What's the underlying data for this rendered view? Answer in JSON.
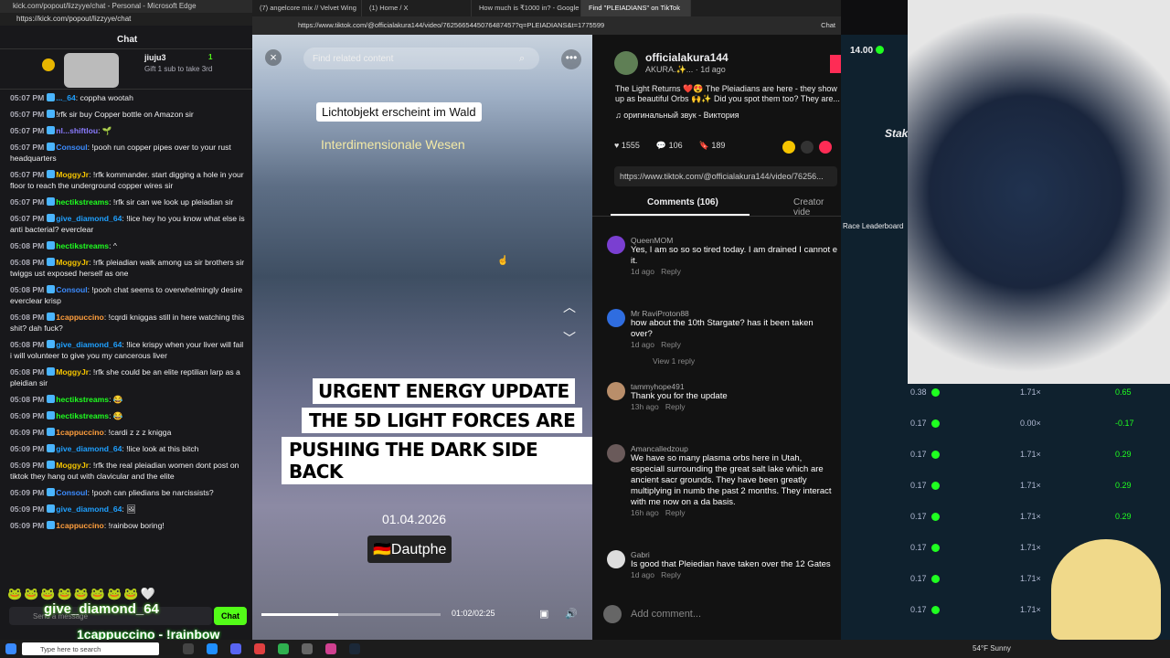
{
  "left": {
    "title": "kick.com/popout/lizzyye/chat - Personal - Microsoft Edge",
    "url": "https://kick.com/popout/lizzyye/chat",
    "header": "Chat",
    "pin_user": "jiuju3",
    "pin_count": "1",
    "pin_text": "Gift 1 sub to take 3rd",
    "messages": [
      {
        "t": "05:07 PM",
        "u": "..._64",
        "c": "#1fa0ff",
        "m": ": coppha wootah"
      },
      {
        "t": "05:07 PM",
        "u": "",
        "c": "#e05b5b",
        "m": "!rfk sir buy Copper bottle on Amazon sir"
      },
      {
        "t": "05:07 PM",
        "u": "nl...shiftlou",
        "c": "#8a7bff",
        "m": ": 🌱"
      },
      {
        "t": "05:07 PM",
        "u": "Consoul",
        "c": "#3c8cff",
        "m": ": !pooh run copper pipes over to your rust headquarters"
      },
      {
        "t": "05:07 PM",
        "u": "MoggyJr",
        "c": "#f5c400",
        "m": ": !rfk kommander. start digging a hole in your floor to reach the underground copper wires sir"
      },
      {
        "t": "05:07 PM",
        "u": "hectikstreams",
        "c": "#1fff20",
        "m": ": !rfk sir can we look up pleiadian sir"
      },
      {
        "t": "05:07 PM",
        "u": "give_diamond_64",
        "c": "#1fa0ff",
        "m": ": !lice hey ho you know what else is anti bacterial? everclear"
      },
      {
        "t": "05:08 PM",
        "u": "hectikstreams",
        "c": "#1fff20",
        "m": ": ^"
      },
      {
        "t": "05:08 PM",
        "u": "MoggyJr",
        "c": "#f5c400",
        "m": ": !rfk pleiadian walk among us sir brothers sir twiggs ust exposed herself as one"
      },
      {
        "t": "05:08 PM",
        "u": "Consoul",
        "c": "#3c8cff",
        "m": ": !pooh chat seems to overwhelmingly desire everclear krisp"
      },
      {
        "t": "05:08 PM",
        "u": "1cappuccino",
        "c": "#ff9e3d",
        "m": ": !cqrdi kniggas still in here watching this shit? dah fuck?"
      },
      {
        "t": "05:08 PM",
        "u": "give_diamond_64",
        "c": "#1fa0ff",
        "m": ": !lice krispy when your liver will fail i will volunteer to give you my cancerous liver"
      },
      {
        "t": "05:08 PM",
        "u": "MoggyJr",
        "c": "#f5c400",
        "m": ": !rfk she could be an elite reptilian larp as a pleidian sir"
      },
      {
        "t": "05:08 PM",
        "u": "hectikstreams",
        "c": "#1fff20",
        "m": ": 😂"
      },
      {
        "t": "05:09 PM",
        "u": "hectikstreams",
        "c": "#1fff20",
        "m": ": 😂"
      },
      {
        "t": "05:09 PM",
        "u": "1cappuccino",
        "c": "#ff9e3d",
        "m": ": !cardi z z z knigga"
      },
      {
        "t": "05:09 PM",
        "u": "give_diamond_64",
        "c": "#1fa0ff",
        "m": ": !lice look at this bitch"
      },
      {
        "t": "05:09 PM",
        "u": "MoggyJr",
        "c": "#f5c400",
        "m": ": !rfk the real pleiadian women dont post on tiktok they hang out with clavicular and the elite"
      },
      {
        "t": "05:09 PM",
        "u": "Consoul",
        "c": "#3c8cff",
        "m": ": !pooh can pliedians be narcissists?"
      },
      {
        "t": "05:09 PM",
        "u": "give_diamond_64",
        "c": "#1fa0ff",
        "m": ": 🖼"
      },
      {
        "t": "05:09 PM",
        "u": "1cappuccino",
        "c": "#ff9e3d",
        "m": ": !rainbow boring!"
      }
    ],
    "input_placeholder": "Send a message",
    "chat_button": "Chat",
    "ticker1": "give_diamond_64",
    "ticker2": "1cappuccino - !rainbow boring!"
  },
  "browser": {
    "tabs": [
      "(7) angelcore mix // Velvet Wing",
      "(1) Home / X",
      "How much is ₹1000 in? - Google",
      "Find \"PLEIADIANS\" on TikTok"
    ],
    "url": "https://www.tiktok.com/@officialakura144/video/7625665445076487457?q=PLEIADIANS&t=1775599",
    "chat_btn": "Chat"
  },
  "video": {
    "search": "Find related content",
    "cap1": "Lichtobjekt erscheint im Wald",
    "cap2": "Interdimensionale Wesen",
    "h1": "URGENT ENERGY UPDATE",
    "h2": "THE 5D LIGHT FORCES ARE",
    "h3": "PUSHING THE DARK SIDE BACK",
    "date": "01.04.2026",
    "place": "🇩🇪Dautphe",
    "time": "01:02/02:25",
    "progress": 0.43
  },
  "panel": {
    "user": "officialakura144",
    "sub": "AKURA.✨... · 1d ago",
    "desc": "The Light Returns ❤️😍 The Pleiadians are here - they show up as beautiful Orbs 🙌✨ Did you spot them too? They are...",
    "sound": "♫ оригинальный звук - Виктория",
    "likes": "1555",
    "comments": "106",
    "saves": "189",
    "link": "https://www.tiktok.com/@officialakura144/video/76256...",
    "tab_comments": "Comments (106)",
    "tab_creator": "Creator vide",
    "list": [
      {
        "n": "QueenMOM",
        "m": "Yes, I am so so so tired today. I am drained I cannot e it.",
        "meta": "1d ago",
        "c": "#7a3fd1"
      },
      {
        "n": "Mr RaviProton88",
        "m": "how about the 10th Stargate? has it been taken over?",
        "meta": "1d ago",
        "c": "#2f6de0"
      },
      {
        "n": "tammyhope491",
        "m": "Thank you for the update",
        "meta": "13h ago",
        "c": "#b98e6a"
      },
      {
        "n": "Amancalledzoup",
        "m": "We have so many plasma orbs here in Utah, especiall surrounding the great salt lake which are ancient sacr grounds. They have been greatly multiplying in numb the past 2 months. They interact with me now on a da basis.",
        "meta": "16h ago",
        "c": "#6a5a5a"
      },
      {
        "n": "Gabri",
        "m": "Is good that Pleiedian have taken over the 12 Gates",
        "meta": "1d ago",
        "c": "#ddd"
      }
    ],
    "reply": "Reply",
    "view_reply": "View 1 reply",
    "add_comment": "Add comment..."
  },
  "stake": {
    "balance": "14.00",
    "race": "Race Leaderboard",
    "logo": "Stake",
    "rows": [
      [
        "0.38",
        "1.71×",
        "0.65"
      ],
      [
        "0.17",
        "0.00×",
        "-0.17"
      ],
      [
        "0.17",
        "1.71×",
        "0.29"
      ],
      [
        "0.17",
        "1.71×",
        "0.29"
      ],
      [
        "0.17",
        "1.71×",
        "0.29"
      ],
      [
        "0.17",
        "1.71×",
        ""
      ],
      [
        "0.17",
        "1.71×",
        ""
      ],
      [
        "0.17",
        "1.71×",
        ""
      ]
    ]
  },
  "taskbar": {
    "search": "Type here to search",
    "weather": "54°F Sunny"
  },
  "colors": {
    "kick_green": "#53fc18",
    "tiktok_pink": "#fe2c55",
    "stake_green": "#1fff20"
  }
}
